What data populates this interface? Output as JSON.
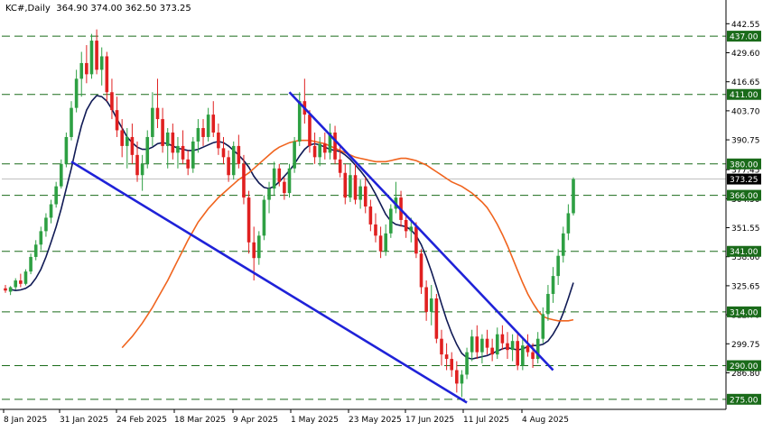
{
  "header": {
    "symbol": "KC#,Daily",
    "ohlc": "364.90 374.00 362.50 373.25"
  },
  "colors": {
    "bull": "#2ea043",
    "bear": "#e02020",
    "level_line": "#1a6b1a",
    "trendline": "#1f22d8",
    "ma_fast": "#101a55",
    "ma_slow": "#f0641e",
    "label_bg": "#1a6b1a",
    "price_label_bg": "#000000"
  },
  "chart_data": {
    "type": "candlestick",
    "timeframe": "Daily",
    "ylim": [
      270.5,
      447.5
    ],
    "x_ticks": [
      "8 Jan 2025",
      "31 Jan 2025",
      "24 Feb 2025",
      "18 Mar 2025",
      "9 Apr 2025",
      "1 May 2025",
      "23 May 2025",
      "17 Jun 2025",
      "11 Jul 2025",
      "4 Aug 2025"
    ],
    "y_ticks": [
      "442.55",
      "429.60",
      "416.65",
      "403.70",
      "390.75",
      "377.45",
      "364.50",
      "351.55",
      "338.60",
      "325.65",
      "312.70",
      "299.75",
      "286.80"
    ],
    "horizontal_levels": [
      "437.00",
      "411.00",
      "380.00",
      "366.00",
      "341.00",
      "314.00",
      "290.00",
      "275.00"
    ],
    "current_price": "373.25",
    "candles_ohlc": [
      [
        324.5,
        326.0,
        322.5,
        323.5
      ],
      [
        323.0,
        325.5,
        321.5,
        325.0
      ],
      [
        325.0,
        329.0,
        323.8,
        328.0
      ],
      [
        328.0,
        331.0,
        325.0,
        326.5
      ],
      [
        326.5,
        333.0,
        325.8,
        332.0
      ],
      [
        332.0,
        340.0,
        330.8,
        338.5
      ],
      [
        338.5,
        346.0,
        337.0,
        344.0
      ],
      [
        344.0,
        352.0,
        341.5,
        350.0
      ],
      [
        350.0,
        358.0,
        347.5,
        356.0
      ],
      [
        356.0,
        364.0,
        353.5,
        362.0
      ],
      [
        362.0,
        372.0,
        360.5,
        370.0
      ],
      [
        370.0,
        382.0,
        369.0,
        380.0
      ],
      [
        380.0,
        394.0,
        378.5,
        392.0
      ],
      [
        392.0,
        408.0,
        390.5,
        405.0
      ],
      [
        405.0,
        422.0,
        403.0,
        418.0
      ],
      [
        418.0,
        430.0,
        410.0,
        425.0
      ],
      [
        425.0,
        433.0,
        416.0,
        420.0
      ],
      [
        420.0,
        438.0,
        418.0,
        435.0
      ],
      [
        435.0,
        440.0,
        420.0,
        422.0
      ],
      [
        422.0,
        432.0,
        415.0,
        428.0
      ],
      [
        428.0,
        430.0,
        408.0,
        412.0
      ],
      [
        412.0,
        418.0,
        400.0,
        404.0
      ],
      [
        404.0,
        410.0,
        392.0,
        395.0
      ],
      [
        395.0,
        400.0,
        383.0,
        388.0
      ],
      [
        388.0,
        396.0,
        378.0,
        392.0
      ],
      [
        392.0,
        398.0,
        380.0,
        384.0
      ],
      [
        384.0,
        390.0,
        372.0,
        375.0
      ],
      [
        375.0,
        384.0,
        368.0,
        380.0
      ],
      [
        380.0,
        395.0,
        378.0,
        392.0
      ],
      [
        392.0,
        412.0,
        388.0,
        405.0
      ],
      [
        405.0,
        418.0,
        396.0,
        400.0
      ],
      [
        400.0,
        405.0,
        385.0,
        388.0
      ],
      [
        388.0,
        396.0,
        378.0,
        394.0
      ],
      [
        394.0,
        398.0,
        382.0,
        385.0
      ],
      [
        385.0,
        392.0,
        378.0,
        388.0
      ],
      [
        388.0,
        395.0,
        380.0,
        382.0
      ],
      [
        382.0,
        386.0,
        375.0,
        378.0
      ],
      [
        378.0,
        392.0,
        376.0,
        390.0
      ],
      [
        390.0,
        400.0,
        385.0,
        396.0
      ],
      [
        396.0,
        400.0,
        388.0,
        392.0
      ],
      [
        392.0,
        405.0,
        390.0,
        402.0
      ],
      [
        402.0,
        408.0,
        392.0,
        394.0
      ],
      [
        394.0,
        398.0,
        384.0,
        387.0
      ],
      [
        387.0,
        392.0,
        380.0,
        383.0
      ],
      [
        383.0,
        386.0,
        372.0,
        375.0
      ],
      [
        375.0,
        390.0,
        373.0,
        388.0
      ],
      [
        388.0,
        393.0,
        378.0,
        380.0
      ],
      [
        380.0,
        384.0,
        362.0,
        365.0
      ],
      [
        365.0,
        368.0,
        340.0,
        345.0
      ],
      [
        345.0,
        352.0,
        328.0,
        338.0
      ],
      [
        338.0,
        350.0,
        335.0,
        348.0
      ],
      [
        348.0,
        366.0,
        346.0,
        364.0
      ],
      [
        364.0,
        372.0,
        358.0,
        369.0
      ],
      [
        369.0,
        381.0,
        366.0,
        378.0
      ],
      [
        378.0,
        380.0,
        370.0,
        372.0
      ],
      [
        372.0,
        374.0,
        364.0,
        367.0
      ],
      [
        367.0,
        380.0,
        365.0,
        378.0
      ],
      [
        378.0,
        392.0,
        376.0,
        390.0
      ],
      [
        390.0,
        412.0,
        388.0,
        408.0
      ],
      [
        408.0,
        418.0,
        398.0,
        402.0
      ],
      [
        402.0,
        404.0,
        385.0,
        388.0
      ],
      [
        388.0,
        394.0,
        380.0,
        383.0
      ],
      [
        383.0,
        392.0,
        379.0,
        389.0
      ],
      [
        389.0,
        394.0,
        382.0,
        385.0
      ],
      [
        385.0,
        398.0,
        382.0,
        394.0
      ],
      [
        394.0,
        397.0,
        380.0,
        382.0
      ],
      [
        382.0,
        388.0,
        374.0,
        376.0
      ],
      [
        376.0,
        380.0,
        362.0,
        365.0
      ],
      [
        365.0,
        380.0,
        363.0,
        375.0
      ],
      [
        375.0,
        380.0,
        362.0,
        364.0
      ],
      [
        364.0,
        373.0,
        360.0,
        370.0
      ],
      [
        370.0,
        374.0,
        358.0,
        361.0
      ],
      [
        361.0,
        364.0,
        350.0,
        353.0
      ],
      [
        353.0,
        358.0,
        345.0,
        348.0
      ],
      [
        348.0,
        352.0,
        338.0,
        341.0
      ],
      [
        341.0,
        353.0,
        339.0,
        349.0
      ],
      [
        349.0,
        362.0,
        347.0,
        360.0
      ],
      [
        360.0,
        372.0,
        358.0,
        365.0
      ],
      [
        365.0,
        368.0,
        352.0,
        355.0
      ],
      [
        355.0,
        358.0,
        347.0,
        350.0
      ],
      [
        350.0,
        356.0,
        345.0,
        352.0
      ],
      [
        352.0,
        354.0,
        338.0,
        340.0
      ],
      [
        340.0,
        342.0,
        322.0,
        325.0
      ],
      [
        325.0,
        328.0,
        310.0,
        314.0
      ],
      [
        314.0,
        326.0,
        308.0,
        320.0
      ],
      [
        320.0,
        322.0,
        300.0,
        302.0
      ],
      [
        302.0,
        306.0,
        290.0,
        295.0
      ],
      [
        295.0,
        300.0,
        288.0,
        293.0
      ],
      [
        293.0,
        296.0,
        285.0,
        288.0
      ],
      [
        288.0,
        292.0,
        278.0,
        282.0
      ],
      [
        282.0,
        288.0,
        276.0,
        286.0
      ],
      [
        286.0,
        298.0,
        284.0,
        296.0
      ],
      [
        296.0,
        306.0,
        292.0,
        303.0
      ],
      [
        303.0,
        308.0,
        293.0,
        296.0
      ],
      [
        296.0,
        304.0,
        291.0,
        302.0
      ],
      [
        302.0,
        306.0,
        295.0,
        298.0
      ],
      [
        298.0,
        302.0,
        292.0,
        295.0
      ],
      [
        295.0,
        307.0,
        293.0,
        304.0
      ],
      [
        304.0,
        308.0,
        297.0,
        300.0
      ],
      [
        300.0,
        305.0,
        293.0,
        297.0
      ],
      [
        297.0,
        304.0,
        292.0,
        301.0
      ],
      [
        301.0,
        305.0,
        288.0,
        290.0
      ],
      [
        290.0,
        302.0,
        288.0,
        299.0
      ],
      [
        299.0,
        304.0,
        294.0,
        296.0
      ],
      [
        296.0,
        300.0,
        289.0,
        293.0
      ],
      [
        293.0,
        305.0,
        291.0,
        302.0
      ],
      [
        302.0,
        316.0,
        300.0,
        313.0
      ],
      [
        313.0,
        326.0,
        310.0,
        322.0
      ],
      [
        322.0,
        334.0,
        318.0,
        330.0
      ],
      [
        330.0,
        342.0,
        326.0,
        339.0
      ],
      [
        339.0,
        352.0,
        336.0,
        349.0
      ],
      [
        349.0,
        362.0,
        346.0,
        358.0
      ],
      [
        358.0,
        374.0,
        357.0,
        373.25
      ]
    ],
    "moving_averages": [
      {
        "color": "ma_fast",
        "values": [
          324.0,
          323.5,
          323.8,
          324.5,
          326.0,
          329.0,
          333.0,
          338.5,
          345.0,
          352.0,
          360.0,
          369.0,
          378.0,
          388.0,
          397.0,
          404.0,
          408.0,
          410.5,
          410.0,
          408.0,
          404.5,
          400.0,
          396.0,
          392.0,
          389.5,
          387.5,
          386.5,
          386.5,
          387.5,
          389.0,
          389.5,
          389.0,
          388.0,
          387.0,
          386.5,
          386.0,
          386.0,
          386.5,
          387.5,
          388.5,
          389.5,
          390.0,
          389.5,
          388.0,
          386.0,
          384.0,
          381.5,
          378.5,
          374.5,
          371.5,
          369.5,
          369.0,
          370.0,
          372.0,
          374.5,
          377.0,
          380.0,
          383.5,
          386.5,
          388.5,
          389.0,
          388.5,
          387.5,
          386.5,
          386.0,
          385.5,
          384.0,
          382.0,
          379.5,
          377.0,
          374.0,
          370.5,
          366.5,
          362.0,
          357.5,
          354.5,
          353.0,
          352.5,
          352.0,
          350.5,
          348.0,
          344.0,
          338.5,
          332.0,
          325.0,
          317.5,
          310.5,
          304.5,
          299.5,
          295.5,
          293.5,
          293.0,
          293.5,
          294.0,
          294.5,
          295.5,
          296.5,
          297.5,
          298.0,
          297.5,
          297.0,
          297.5,
          298.5,
          299.0,
          299.0,
          299.5,
          301.0,
          304.0,
          308.0,
          313.5,
          320.0,
          327.0
        ]
      },
      {
        "color": "ma_slow",
        "values": [
          298.0,
          300.5,
          303.0,
          306.0,
          309.0,
          312.5,
          316.0,
          320.0,
          324.0,
          328.0,
          332.5,
          337.0,
          341.5,
          346.0,
          350.0,
          354.0,
          357.0,
          360.0,
          362.5,
          365.0,
          367.0,
          369.0,
          371.0,
          373.0,
          374.5,
          376.0,
          378.0,
          380.0,
          382.0,
          384.0,
          386.0,
          387.5,
          388.5,
          389.5,
          390.0,
          390.5,
          390.5,
          390.5,
          390.0,
          389.5,
          389.0,
          388.0,
          387.0,
          386.0,
          385.0,
          384.0,
          383.0,
          382.5,
          382.0,
          381.5,
          381.0,
          381.0,
          381.0,
          381.5,
          382.0,
          382.5,
          382.5,
          382.0,
          381.5,
          380.5,
          379.5,
          378.0,
          376.5,
          375.0,
          373.5,
          372.0,
          371.0,
          370.0,
          368.5,
          367.0,
          365.0,
          363.0,
          360.5,
          357.0,
          353.0,
          348.5,
          343.5,
          338.0,
          332.5,
          327.0,
          322.0,
          318.0,
          314.5,
          312.0,
          311.0,
          310.5,
          310.0,
          310.0,
          310.0,
          310.5
        ]
      }
    ],
    "trendlines": [
      "upper_descending",
      "lower_descending"
    ]
  }
}
